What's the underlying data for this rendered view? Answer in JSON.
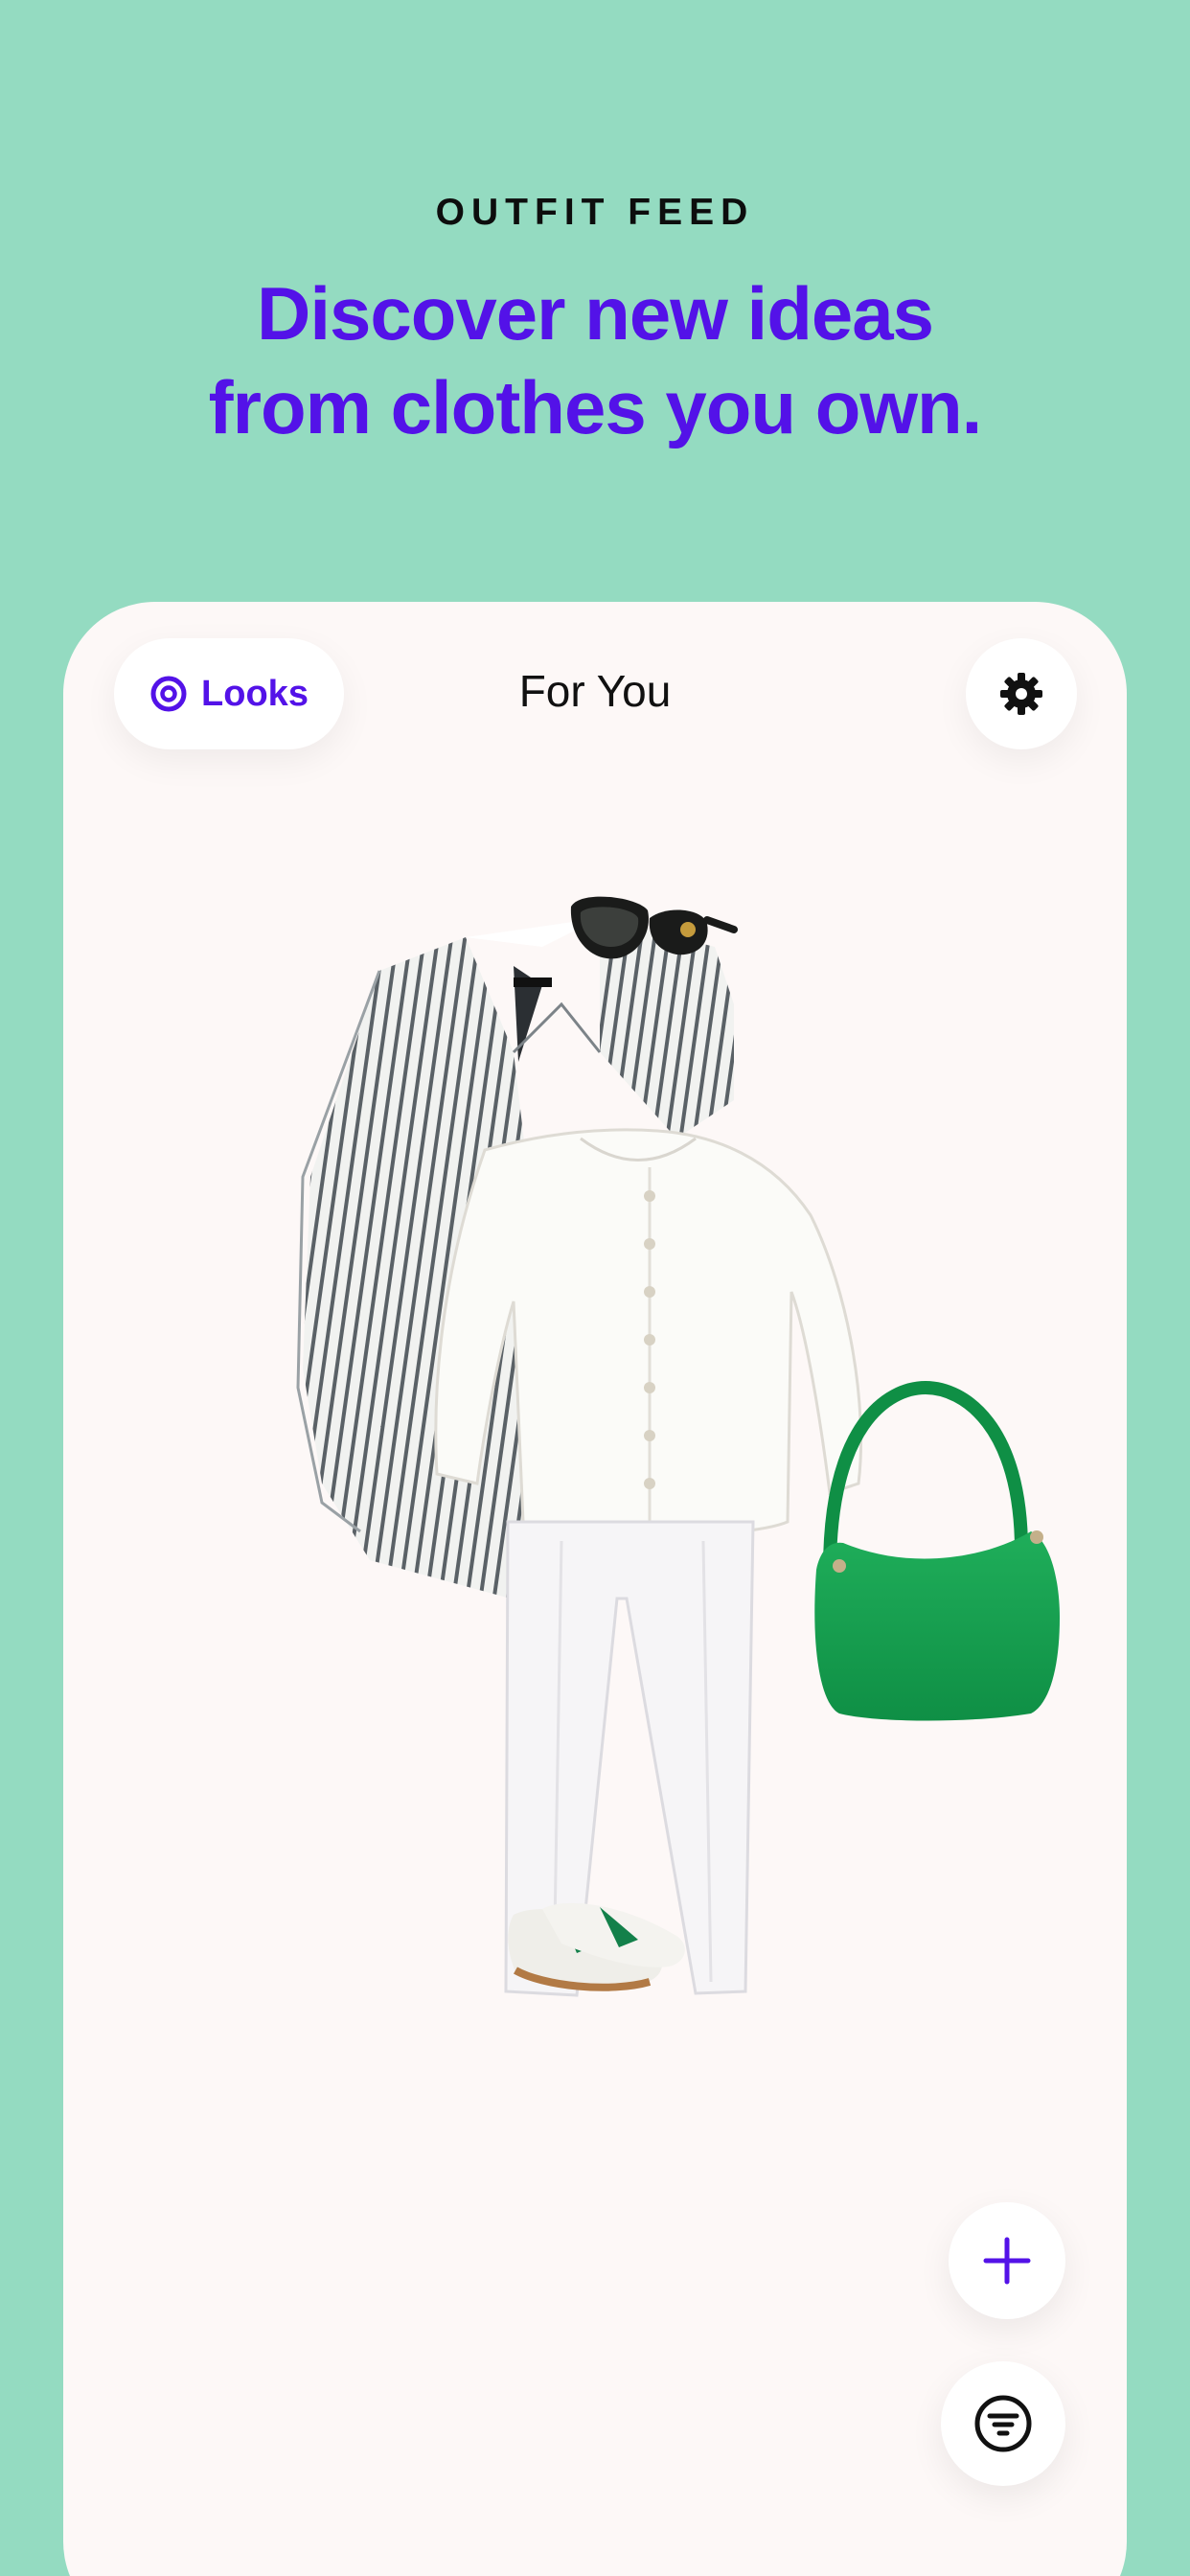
{
  "header": {
    "eyebrow": "OUTFIT FEED",
    "headline_line1": "Discover new ideas",
    "headline_line2": "from clothes you own."
  },
  "nav": {
    "looks_label": "Looks",
    "title": "For You",
    "settings_icon": "gear-icon",
    "looks_icon": "target-icon"
  },
  "outfit": {
    "items": [
      "sunglasses",
      "striped blazer",
      "white blouse",
      "white trousers",
      "green shoulder bag",
      "sneakers"
    ]
  },
  "actions": {
    "add_icon": "plus-icon",
    "filter_icon": "filter-icon"
  },
  "colors": {
    "background": "#94dbc1",
    "accent": "#5312e8",
    "card": "#fdf8f7"
  }
}
